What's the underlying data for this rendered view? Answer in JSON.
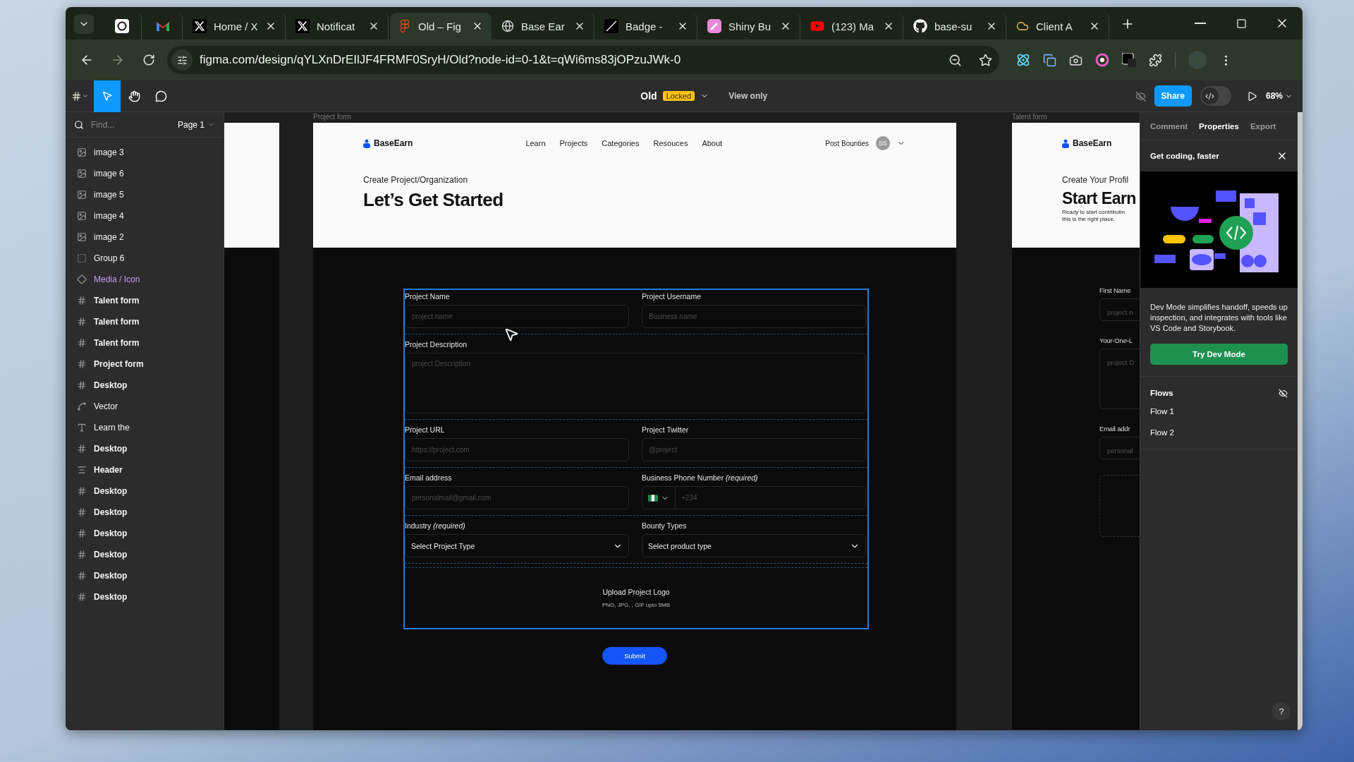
{
  "browser": {
    "tabs": [
      {
        "kind": "openai",
        "pinned": true,
        "selected": false
      },
      {
        "kind": "gmail",
        "pinned": true,
        "selected": false
      },
      {
        "kind": "x",
        "pinned": false,
        "title": "Home / X",
        "selected": false
      },
      {
        "kind": "x",
        "pinned": false,
        "title": "Notificat",
        "selected": false
      },
      {
        "kind": "figma",
        "pinned": false,
        "title": "Old – Fig",
        "selected": true
      },
      {
        "kind": "globe",
        "pinned": false,
        "title": "Base Ear",
        "selected": false
      },
      {
        "kind": "badge",
        "pinned": false,
        "title": "Badge -",
        "selected": false
      },
      {
        "kind": "shiny",
        "pinned": false,
        "title": "Shiny Bu",
        "selected": false
      },
      {
        "kind": "youtube",
        "pinned": false,
        "title": "(123) Ma",
        "selected": false
      },
      {
        "kind": "github",
        "pinned": false,
        "title": "base-su",
        "selected": false
      },
      {
        "kind": "cloud",
        "pinned": false,
        "title": "Client A",
        "selected": false
      }
    ],
    "address": "figma.com/design/qYLXnDrEIlJF4FRMF0SryH/Old?node-id=0-1&t=qWi6ms83jOPzuJWk-0"
  },
  "figma": {
    "file_name": "Old",
    "badge": "Locked",
    "mode": "View only",
    "share": "Share",
    "dev_mode_on": false,
    "zoom": "68%",
    "tools": [
      {
        "kind": "move",
        "selected": true
      },
      {
        "kind": "hand",
        "selected": false
      },
      {
        "kind": "comment",
        "selected": false
      }
    ]
  },
  "layers": {
    "search_placeholder": "Find...",
    "page": "Page 1",
    "items": [
      {
        "kind": "image",
        "name": "image 3"
      },
      {
        "kind": "image",
        "name": "image 6"
      },
      {
        "kind": "image",
        "name": "image 5"
      },
      {
        "kind": "image",
        "name": "image 4"
      },
      {
        "kind": "image",
        "name": "image 2"
      },
      {
        "kind": "group",
        "name": "Group 6"
      },
      {
        "kind": "component",
        "name": "Media / Icon"
      },
      {
        "kind": "frame",
        "name": "Talent form"
      },
      {
        "kind": "frame",
        "name": "Talent form"
      },
      {
        "kind": "frame",
        "name": "Talent form"
      },
      {
        "kind": "frame",
        "name": "Project form"
      },
      {
        "kind": "frame",
        "name": "Desktop"
      },
      {
        "kind": "vector",
        "name": "Vector"
      },
      {
        "kind": "text",
        "name": "Learn the"
      },
      {
        "kind": "frame",
        "name": "Desktop"
      },
      {
        "kind": "stack",
        "name": "Header"
      },
      {
        "kind": "frame",
        "name": "Desktop"
      },
      {
        "kind": "frame",
        "name": "Desktop"
      },
      {
        "kind": "frame",
        "name": "Desktop"
      },
      {
        "kind": "frame",
        "name": "Desktop"
      },
      {
        "kind": "frame",
        "name": "Desktop"
      },
      {
        "kind": "frame",
        "name": "Desktop"
      }
    ]
  },
  "main_frame": {
    "title": "Project form",
    "brand": "BaseEarn",
    "nav": [
      "Learn",
      "Projects",
      "Categories",
      "Resouces",
      "About"
    ],
    "post": "Post Bounties",
    "avatar": "SS",
    "eyebrow": "Create Project/Organization",
    "heading": "Let’s Get Started",
    "form": {
      "selected": true,
      "rows": [
        [
          {
            "kind": "text",
            "label": "Project Name",
            "placeholder": "project name"
          },
          {
            "kind": "text",
            "label": "Project Username",
            "placeholder": "Business name"
          }
        ],
        [
          {
            "kind": "textarea",
            "label": "Project Description",
            "placeholder": "project Description"
          }
        ],
        [
          {
            "kind": "text",
            "label": "Project URL",
            "placeholder": "https://project.com"
          },
          {
            "kind": "text",
            "label": "Project Twitter",
            "placeholder": "@project"
          }
        ],
        [
          {
            "kind": "text",
            "label": "Email address",
            "placeholder": "personalmail@gmail.com"
          },
          {
            "kind": "phone",
            "label": "Business Phone Number *(required)*",
            "placeholder": "+234"
          }
        ],
        [
          {
            "kind": "select",
            "label": "Industry *(required)*",
            "value": "Select Project Type"
          },
          {
            "kind": "select",
            "label": "Bounty Types",
            "value": "Select product type"
          }
        ]
      ],
      "upload": {
        "title": "Upload Project Logo",
        "hint": "PNG, JPG, , GIF upto 5MB"
      }
    },
    "submit": "Submit"
  },
  "right_frame": {
    "title": "Talent form",
    "brand": "BaseEarn",
    "eyebrow": "Create Your Profil",
    "heading": "Start Earn",
    "intro": [
      "Ready to start contributin",
      "this is the right place."
    ],
    "fields": [
      {
        "kind": "text",
        "label": "First Name",
        "placeholder": "project n"
      },
      {
        "kind": "textarea",
        "label": "Your-One-L",
        "placeholder": "project D"
      },
      {
        "kind": "text",
        "label": "Email addr",
        "placeholder": "personal"
      }
    ]
  },
  "panel": {
    "tabs": [
      {
        "label": "Comment",
        "selected": false
      },
      {
        "label": "Properties",
        "selected": true
      },
      {
        "label": "Export",
        "selected": false
      }
    ],
    "promo": {
      "title": "Get coding, faster",
      "text": "Dev Mode simplifies handoff, speeds up inspection, and integrates with tools like VS Code and Storybook.",
      "button": "Try Dev Mode"
    },
    "flows": {
      "title": "Flows",
      "items": [
        "Flow 1",
        "Flow 2"
      ]
    },
    "help": "?"
  }
}
